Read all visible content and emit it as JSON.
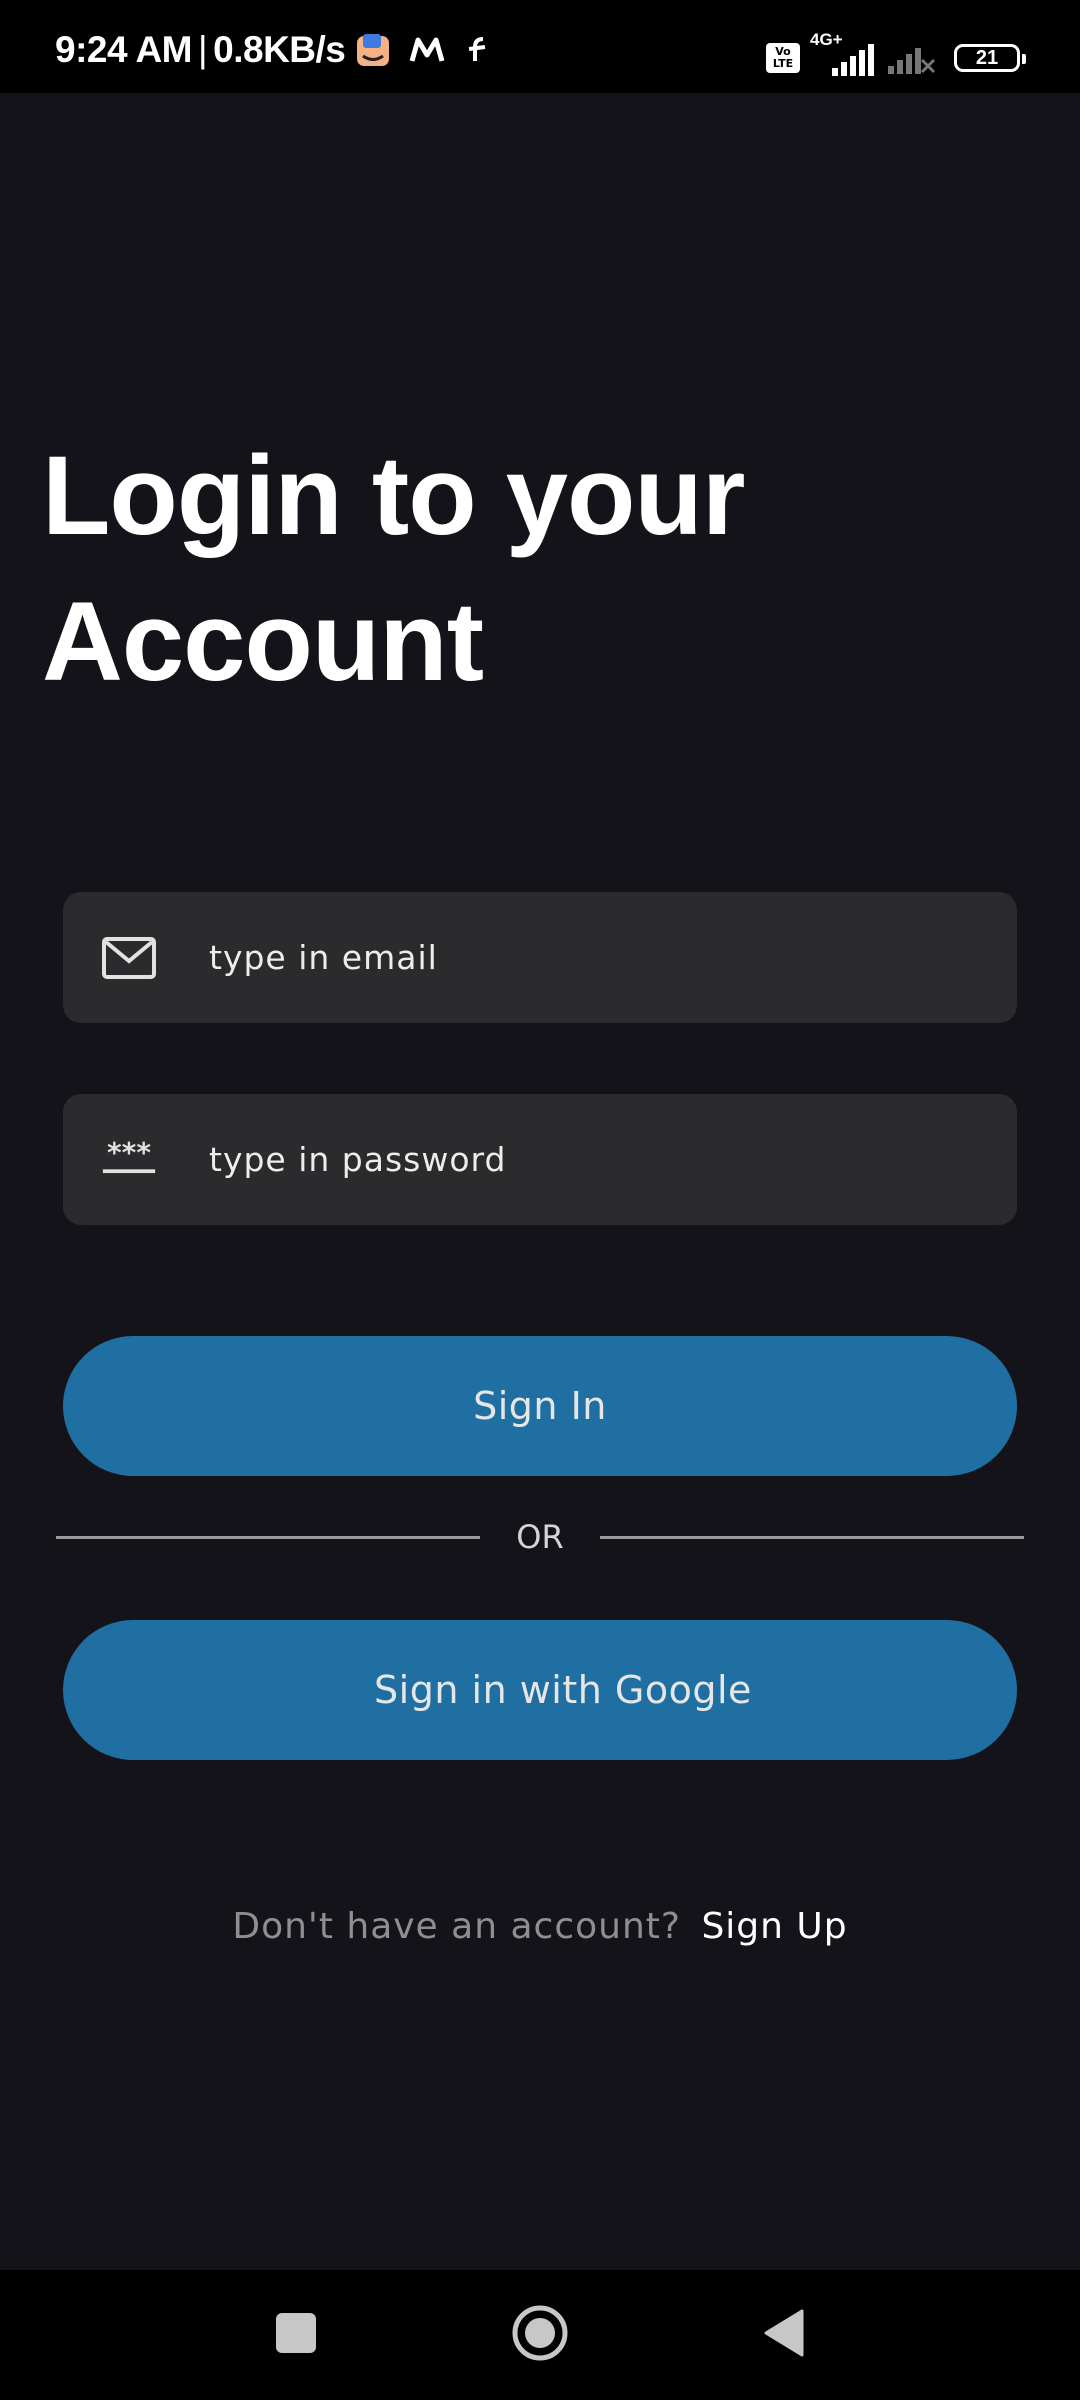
{
  "status_bar": {
    "time": "9:24 AM",
    "separator": "|",
    "net_speed": "0.8KB/s",
    "network_type": "4G+",
    "volte_line1": "Vo",
    "volte_line2": "LTE",
    "battery_level": "21"
  },
  "login": {
    "title_line1": "Login to your",
    "title_line2": "Account",
    "email_placeholder": "type in email",
    "password_placeholder": "type in password",
    "password_icon_text": "***",
    "sign_in_label": "Sign In",
    "divider_label": "OR",
    "google_label": "Sign in with Google",
    "signup_prompt": "Don't have an account?",
    "signup_link": "Sign Up"
  },
  "colors": {
    "background": "#15131a",
    "field_background": "#2b2b2d",
    "button_background": "#1f6fa2",
    "text_primary": "#ffffff",
    "text_muted": "#8f8f8f"
  },
  "icons": {
    "email": "envelope-icon",
    "password": "password-dots-icon",
    "nav_recents": "square-icon",
    "nav_home": "circle-icon",
    "nav_back": "triangle-back-icon"
  }
}
